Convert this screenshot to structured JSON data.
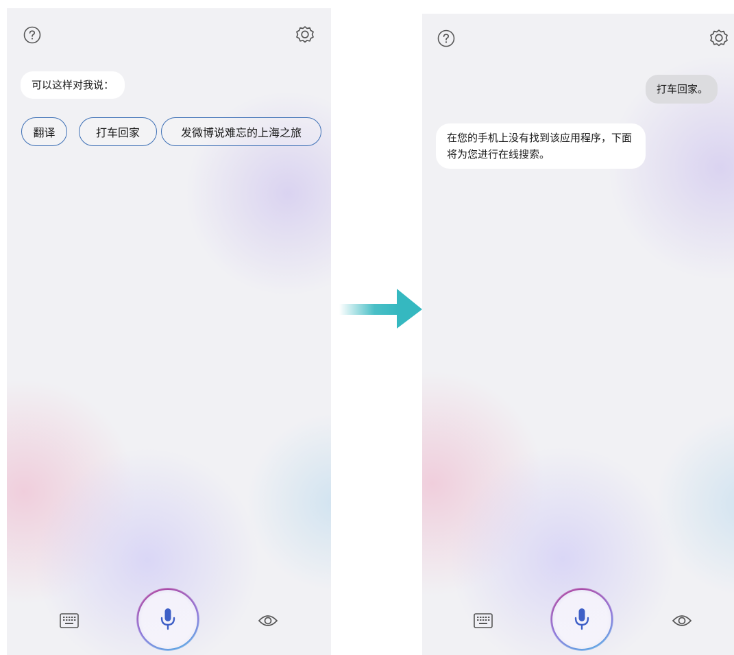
{
  "left_screen": {
    "suggestion_heading": "可以这样对我说：",
    "chips": [
      {
        "label": "翻译"
      },
      {
        "label": "打车回家"
      },
      {
        "label": "发微博说难忘的上海之旅"
      }
    ]
  },
  "right_screen": {
    "user_message": "打车回家。",
    "assistant_message_line1": "在您的手机上没有找到该应用程序，下面",
    "assistant_message_line2": "将为您进行在线搜索。"
  },
  "icons": {
    "top_left": "help-icon",
    "top_right": "settings-icon",
    "bottom_left": "keyboard-icon",
    "bottom_center": "microphone-icon",
    "bottom_right": "eye-icon",
    "transition": "arrow-right-icon"
  },
  "colors": {
    "chip_border": "#3c6fb5",
    "mic_blue": "#3e5fc7",
    "arrow": "#35b8c0"
  }
}
